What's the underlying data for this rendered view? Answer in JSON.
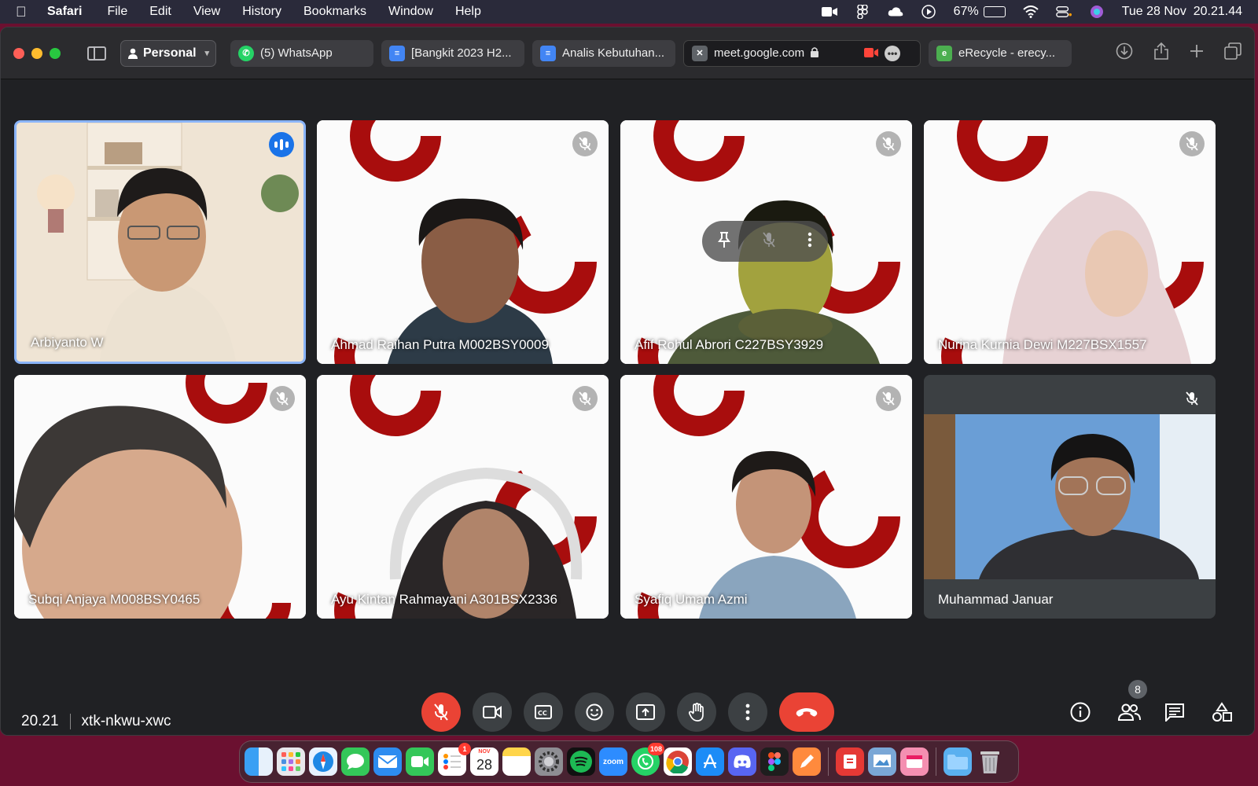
{
  "menubar": {
    "app_name": "Safari",
    "menus": [
      "File",
      "Edit",
      "View",
      "History",
      "Bookmarks",
      "Window",
      "Help"
    ],
    "battery_percent": "67%",
    "battery_level": 0.67,
    "datetime": "Tue 28 Nov  20.21.44"
  },
  "browser": {
    "profile": "Personal",
    "tabs": [
      {
        "title": "(5) WhatsApp",
        "icon": "whatsapp-icon"
      },
      {
        "title": "[Bangkit 2023 H2...",
        "icon": "google-docs-icon"
      },
      {
        "title": "Analis Kebutuhan...",
        "icon": "google-docs-icon"
      },
      {
        "title": "meet.google.com",
        "icon": "close-icon",
        "active": true
      },
      {
        "title": "eRecycle - erecy...",
        "icon": "erecycle-icon"
      }
    ]
  },
  "meet": {
    "participants": [
      {
        "name": "Arbiyanto W",
        "speaking": true
      },
      {
        "name": "Ahmad Raihan Putra M002BSY0009",
        "muted": true
      },
      {
        "name": "Afif Rohul Abrori C227BSY3929",
        "muted": true
      },
      {
        "name": "Nurina Kurnia Dewi M227BSX1557",
        "muted": true
      },
      {
        "name": "Subqi Anjaya M008BSY0465",
        "muted": true
      },
      {
        "name": "Ayu Kintan Rahmayani A301BSX2336",
        "muted": true
      },
      {
        "name": "Syafiq Umam Azmi",
        "muted": true
      },
      {
        "name": "Muhammad Januar",
        "muted": true
      }
    ],
    "time": "20.21",
    "meeting_code": "xtk-nkwu-xwc",
    "people_count": "8"
  },
  "dock": {
    "calendar_month": "NOV",
    "calendar_day": "28",
    "reminders_badge": "1",
    "whatsapp_badge": "108",
    "zoom_label": "zoom"
  },
  "colors": {
    "meet_bg": "#202124",
    "end_call": "#ea4335",
    "brand_red": "#a80d0d",
    "speaking_border": "#8ab4f8"
  }
}
